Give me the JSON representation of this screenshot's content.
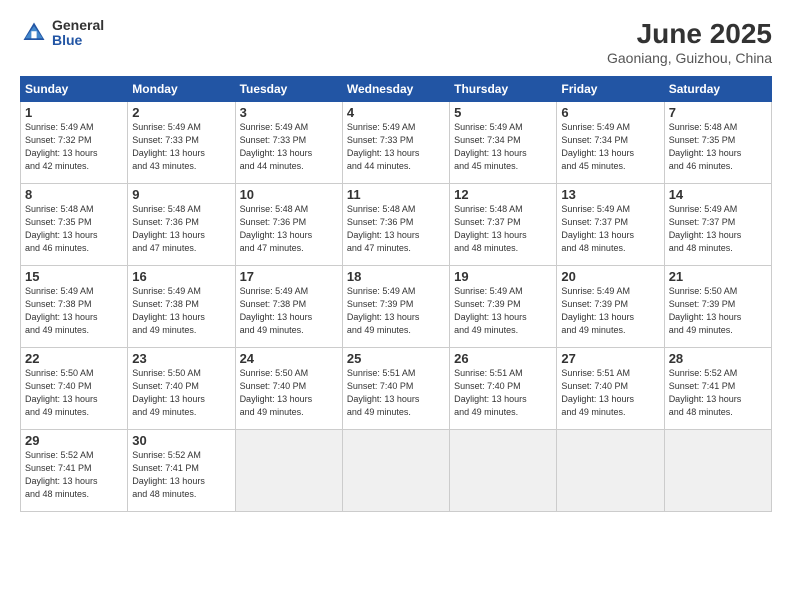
{
  "logo": {
    "general": "General",
    "blue": "Blue"
  },
  "title": "June 2025",
  "subtitle": "Gaoniang, Guizhou, China",
  "weekdays": [
    "Sunday",
    "Monday",
    "Tuesday",
    "Wednesday",
    "Thursday",
    "Friday",
    "Saturday"
  ],
  "weeks": [
    [
      {
        "day": "1",
        "info": "Sunrise: 5:49 AM\nSunset: 7:32 PM\nDaylight: 13 hours\nand 42 minutes."
      },
      {
        "day": "2",
        "info": "Sunrise: 5:49 AM\nSunset: 7:33 PM\nDaylight: 13 hours\nand 43 minutes."
      },
      {
        "day": "3",
        "info": "Sunrise: 5:49 AM\nSunset: 7:33 PM\nDaylight: 13 hours\nand 44 minutes."
      },
      {
        "day": "4",
        "info": "Sunrise: 5:49 AM\nSunset: 7:33 PM\nDaylight: 13 hours\nand 44 minutes."
      },
      {
        "day": "5",
        "info": "Sunrise: 5:49 AM\nSunset: 7:34 PM\nDaylight: 13 hours\nand 45 minutes."
      },
      {
        "day": "6",
        "info": "Sunrise: 5:49 AM\nSunset: 7:34 PM\nDaylight: 13 hours\nand 45 minutes."
      },
      {
        "day": "7",
        "info": "Sunrise: 5:48 AM\nSunset: 7:35 PM\nDaylight: 13 hours\nand 46 minutes."
      }
    ],
    [
      {
        "day": "8",
        "info": "Sunrise: 5:48 AM\nSunset: 7:35 PM\nDaylight: 13 hours\nand 46 minutes."
      },
      {
        "day": "9",
        "info": "Sunrise: 5:48 AM\nSunset: 7:36 PM\nDaylight: 13 hours\nand 47 minutes."
      },
      {
        "day": "10",
        "info": "Sunrise: 5:48 AM\nSunset: 7:36 PM\nDaylight: 13 hours\nand 47 minutes."
      },
      {
        "day": "11",
        "info": "Sunrise: 5:48 AM\nSunset: 7:36 PM\nDaylight: 13 hours\nand 47 minutes."
      },
      {
        "day": "12",
        "info": "Sunrise: 5:48 AM\nSunset: 7:37 PM\nDaylight: 13 hours\nand 48 minutes."
      },
      {
        "day": "13",
        "info": "Sunrise: 5:49 AM\nSunset: 7:37 PM\nDaylight: 13 hours\nand 48 minutes."
      },
      {
        "day": "14",
        "info": "Sunrise: 5:49 AM\nSunset: 7:37 PM\nDaylight: 13 hours\nand 48 minutes."
      }
    ],
    [
      {
        "day": "15",
        "info": "Sunrise: 5:49 AM\nSunset: 7:38 PM\nDaylight: 13 hours\nand 49 minutes."
      },
      {
        "day": "16",
        "info": "Sunrise: 5:49 AM\nSunset: 7:38 PM\nDaylight: 13 hours\nand 49 minutes."
      },
      {
        "day": "17",
        "info": "Sunrise: 5:49 AM\nSunset: 7:38 PM\nDaylight: 13 hours\nand 49 minutes."
      },
      {
        "day": "18",
        "info": "Sunrise: 5:49 AM\nSunset: 7:39 PM\nDaylight: 13 hours\nand 49 minutes."
      },
      {
        "day": "19",
        "info": "Sunrise: 5:49 AM\nSunset: 7:39 PM\nDaylight: 13 hours\nand 49 minutes."
      },
      {
        "day": "20",
        "info": "Sunrise: 5:49 AM\nSunset: 7:39 PM\nDaylight: 13 hours\nand 49 minutes."
      },
      {
        "day": "21",
        "info": "Sunrise: 5:50 AM\nSunset: 7:39 PM\nDaylight: 13 hours\nand 49 minutes."
      }
    ],
    [
      {
        "day": "22",
        "info": "Sunrise: 5:50 AM\nSunset: 7:40 PM\nDaylight: 13 hours\nand 49 minutes."
      },
      {
        "day": "23",
        "info": "Sunrise: 5:50 AM\nSunset: 7:40 PM\nDaylight: 13 hours\nand 49 minutes."
      },
      {
        "day": "24",
        "info": "Sunrise: 5:50 AM\nSunset: 7:40 PM\nDaylight: 13 hours\nand 49 minutes."
      },
      {
        "day": "25",
        "info": "Sunrise: 5:51 AM\nSunset: 7:40 PM\nDaylight: 13 hours\nand 49 minutes."
      },
      {
        "day": "26",
        "info": "Sunrise: 5:51 AM\nSunset: 7:40 PM\nDaylight: 13 hours\nand 49 minutes."
      },
      {
        "day": "27",
        "info": "Sunrise: 5:51 AM\nSunset: 7:40 PM\nDaylight: 13 hours\nand 49 minutes."
      },
      {
        "day": "28",
        "info": "Sunrise: 5:52 AM\nSunset: 7:41 PM\nDaylight: 13 hours\nand 48 minutes."
      }
    ],
    [
      {
        "day": "29",
        "info": "Sunrise: 5:52 AM\nSunset: 7:41 PM\nDaylight: 13 hours\nand 48 minutes."
      },
      {
        "day": "30",
        "info": "Sunrise: 5:52 AM\nSunset: 7:41 PM\nDaylight: 13 hours\nand 48 minutes."
      },
      {
        "day": "",
        "info": ""
      },
      {
        "day": "",
        "info": ""
      },
      {
        "day": "",
        "info": ""
      },
      {
        "day": "",
        "info": ""
      },
      {
        "day": "",
        "info": ""
      }
    ]
  ]
}
